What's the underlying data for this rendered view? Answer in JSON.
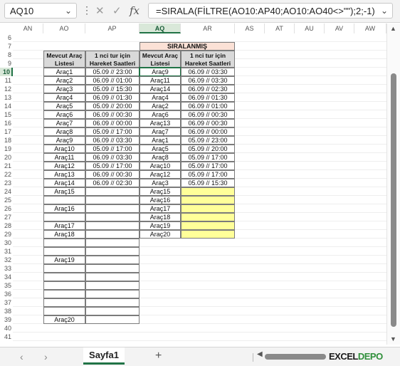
{
  "namebox": {
    "value": "AQ10",
    "chevron": "chevron-down-icon"
  },
  "formula_bar": {
    "text": "=SIRALA(FİLTRE(AO10:AP40;AO10:AO40<>\"\");2;-1)",
    "fx_label": "fx"
  },
  "columns": [
    "AN",
    "AO",
    "AP",
    "AQ",
    "AR",
    "AS",
    "AT",
    "AU",
    "AV",
    "AW"
  ],
  "rows": [
    "6",
    "7",
    "8",
    "9",
    "10",
    "11",
    "12",
    "13",
    "14",
    "15",
    "16",
    "17",
    "18",
    "19",
    "20",
    "21",
    "22",
    "23",
    "24",
    "25",
    "26",
    "27",
    "28",
    "29",
    "30",
    "31",
    "32",
    "33",
    "34",
    "35",
    "36",
    "37",
    "38",
    "39",
    "40",
    "41"
  ],
  "selected_cell": "AQ10",
  "table1": {
    "header1": "Mevcut Araç Listesi",
    "header2": "1 nci tur için Hareket Saatleri",
    "rows": [
      [
        "Araç1",
        "05.09 // 23:00"
      ],
      [
        "Araç2",
        "06.09 // 01:00"
      ],
      [
        "Araç3",
        "05.09 // 15:30"
      ],
      [
        "Araç4",
        "06.09 // 01:30"
      ],
      [
        "Araç5",
        "05.09 // 20:00"
      ],
      [
        "Araç6",
        "06.09 // 00:30"
      ],
      [
        "Araç7",
        "06.09 // 00:00"
      ],
      [
        "Araç8",
        "05.09 // 17:00"
      ],
      [
        "Araç9",
        "06.09 // 03:30"
      ],
      [
        "Araç10",
        "05.09 // 17:00"
      ],
      [
        "Araç11",
        "06.09 // 03:30"
      ],
      [
        "Araç12",
        "05.09 // 17:00"
      ],
      [
        "Araç13",
        "06.09 // 00:30"
      ],
      [
        "Araç14",
        "06.09 // 02:30"
      ],
      [
        "Araç15",
        ""
      ],
      [
        "",
        ""
      ],
      [
        "Araç16",
        ""
      ],
      [
        "",
        ""
      ],
      [
        "Araç17",
        ""
      ],
      [
        "Araç18",
        ""
      ],
      [
        "",
        ""
      ],
      [
        "",
        ""
      ],
      [
        "Araç19",
        ""
      ],
      [
        "",
        ""
      ],
      [
        "",
        ""
      ],
      [
        "",
        ""
      ],
      [
        "",
        ""
      ],
      [
        "",
        ""
      ],
      [
        "",
        ""
      ],
      [
        "Araç20",
        ""
      ]
    ]
  },
  "table2": {
    "title": "SIRALANMIŞ",
    "header1": "Mevcut Araç Listesi",
    "header2": "1 nci tur için Hareket Saatleri",
    "rows": [
      [
        "Araç9",
        "06.09 // 03:30"
      ],
      [
        "Araç11",
        "06.09 // 03:30"
      ],
      [
        "Araç14",
        "06.09 // 02:30"
      ],
      [
        "Araç4",
        "06.09 // 01:30"
      ],
      [
        "Araç2",
        "06.09 // 01:00"
      ],
      [
        "Araç6",
        "06.09 // 00:30"
      ],
      [
        "Araç13",
        "06.09 // 00:30"
      ],
      [
        "Araç7",
        "06.09 // 00:00"
      ],
      [
        "Araç1",
        "05.09 // 23:00"
      ],
      [
        "Araç5",
        "05.09 // 20:00"
      ],
      [
        "Araç8",
        "05.09 // 17:00"
      ],
      [
        "Araç10",
        "05.09 // 17:00"
      ],
      [
        "Araç12",
        "05.09 // 17:00"
      ],
      [
        "Araç3",
        "05.09 // 15:30"
      ],
      [
        "Araç15",
        ""
      ],
      [
        "Araç16",
        ""
      ],
      [
        "Araç17",
        ""
      ],
      [
        "Araç18",
        ""
      ],
      [
        "Araç19",
        ""
      ],
      [
        "Araç20",
        ""
      ]
    ]
  },
  "sheet_tab": "Sayfa1",
  "logo": {
    "part1": "EXCEL",
    "part2": "DEPO",
    "color1": "#1a1a1a",
    "color2": "#2f8f3a"
  },
  "colors": {
    "accent": "#217346",
    "header_gray": "#d9d9d9",
    "pink": "#fbe1d6",
    "yellow": "#ffff99"
  }
}
